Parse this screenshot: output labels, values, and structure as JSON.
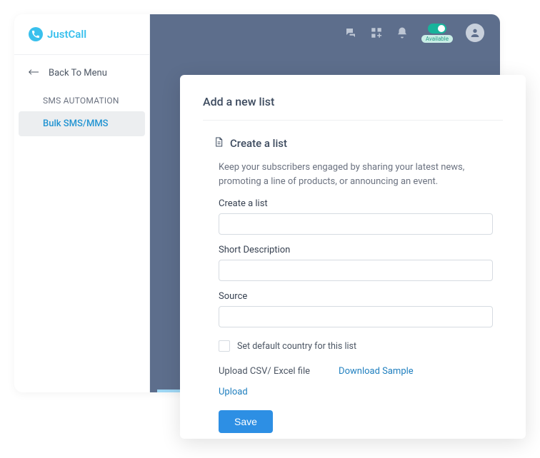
{
  "brand": {
    "name": "JustCall"
  },
  "sidebar": {
    "back_label": "Back To Menu",
    "section_label": "SMS AUTOMATION",
    "nav": {
      "bulk_sms": "Bulk SMS/MMS"
    }
  },
  "topbar": {
    "status_label": "Available"
  },
  "modal": {
    "title": "Add a new list",
    "section_title": "Create a list",
    "description": "Keep your subscribers engaged by sharing your latest news, promoting a line of products, or announcing an event.",
    "fields": {
      "name_label": "Create a list",
      "name_value": "",
      "desc_label": "Short Description",
      "desc_value": "",
      "source_label": "Source",
      "source_value": ""
    },
    "default_country_label": "Set default country for this list",
    "upload_label": "Upload CSV/ Excel file",
    "download_sample": "Download Sample",
    "upload_action": "Upload",
    "save_label": "Save"
  }
}
